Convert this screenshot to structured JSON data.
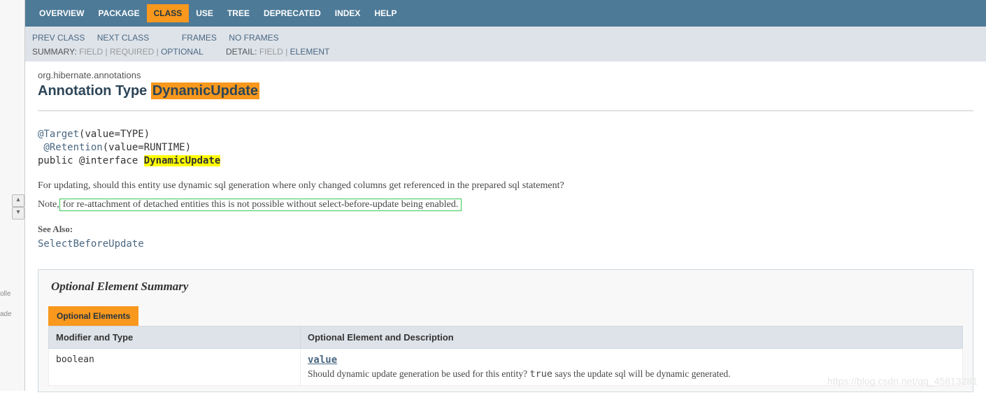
{
  "topnav": {
    "items": [
      {
        "label": "OVERVIEW",
        "selected": false
      },
      {
        "label": "PACKAGE",
        "selected": false
      },
      {
        "label": "CLASS",
        "selected": true
      },
      {
        "label": "USE",
        "selected": false
      },
      {
        "label": "TREE",
        "selected": false
      },
      {
        "label": "DEPRECATED",
        "selected": false
      },
      {
        "label": "INDEX",
        "selected": false
      },
      {
        "label": "HELP",
        "selected": false
      }
    ]
  },
  "subnav": {
    "prev_class": "PREV CLASS",
    "next_class": "NEXT CLASS",
    "frames": "FRAMES",
    "no_frames": "NO FRAMES",
    "summary_label": "SUMMARY:",
    "summary_field": "FIELD",
    "summary_required": "REQUIRED",
    "summary_optional": "OPTIONAL",
    "detail_label": "DETAIL:",
    "detail_field": "FIELD",
    "detail_element": "ELEMENT"
  },
  "package_name": "org.hibernate.annotations",
  "title_prefix": "Annotation Type ",
  "title_name": "DynamicUpdate",
  "signature": {
    "target": "@Target",
    "target_val": "(value=TYPE)",
    "retention": " @Retention",
    "retention_val": "(value=RUNTIME)",
    "decl": "public @interface ",
    "name": "DynamicUpdate"
  },
  "description": "For updating, should this entity use dynamic sql generation where only changed columns get referenced in the prepared sql statement?",
  "note_prefix": "Note,",
  "note_boxed": " for re-attachment of detached entities this is not possible without select-before-update being enabled.",
  "see_also_label": "See Also:",
  "see_also_link": "SelectBeforeUpdate",
  "summary": {
    "heading": "Optional Element Summary",
    "tab": "Optional Elements",
    "col1": "Modifier and Type",
    "col2": "Optional Element and Description",
    "rows": [
      {
        "type": "boolean",
        "name": "value",
        "desc_pre": "Should dynamic update generation be used for this entity? ",
        "desc_code": "true",
        "desc_post": " says the update sql will be dynamic generated."
      }
    ]
  },
  "left_gutter": {
    "w1": "olle",
    "w2": "ade"
  },
  "watermark": "https://blog.csdn.net/qq_45813281"
}
